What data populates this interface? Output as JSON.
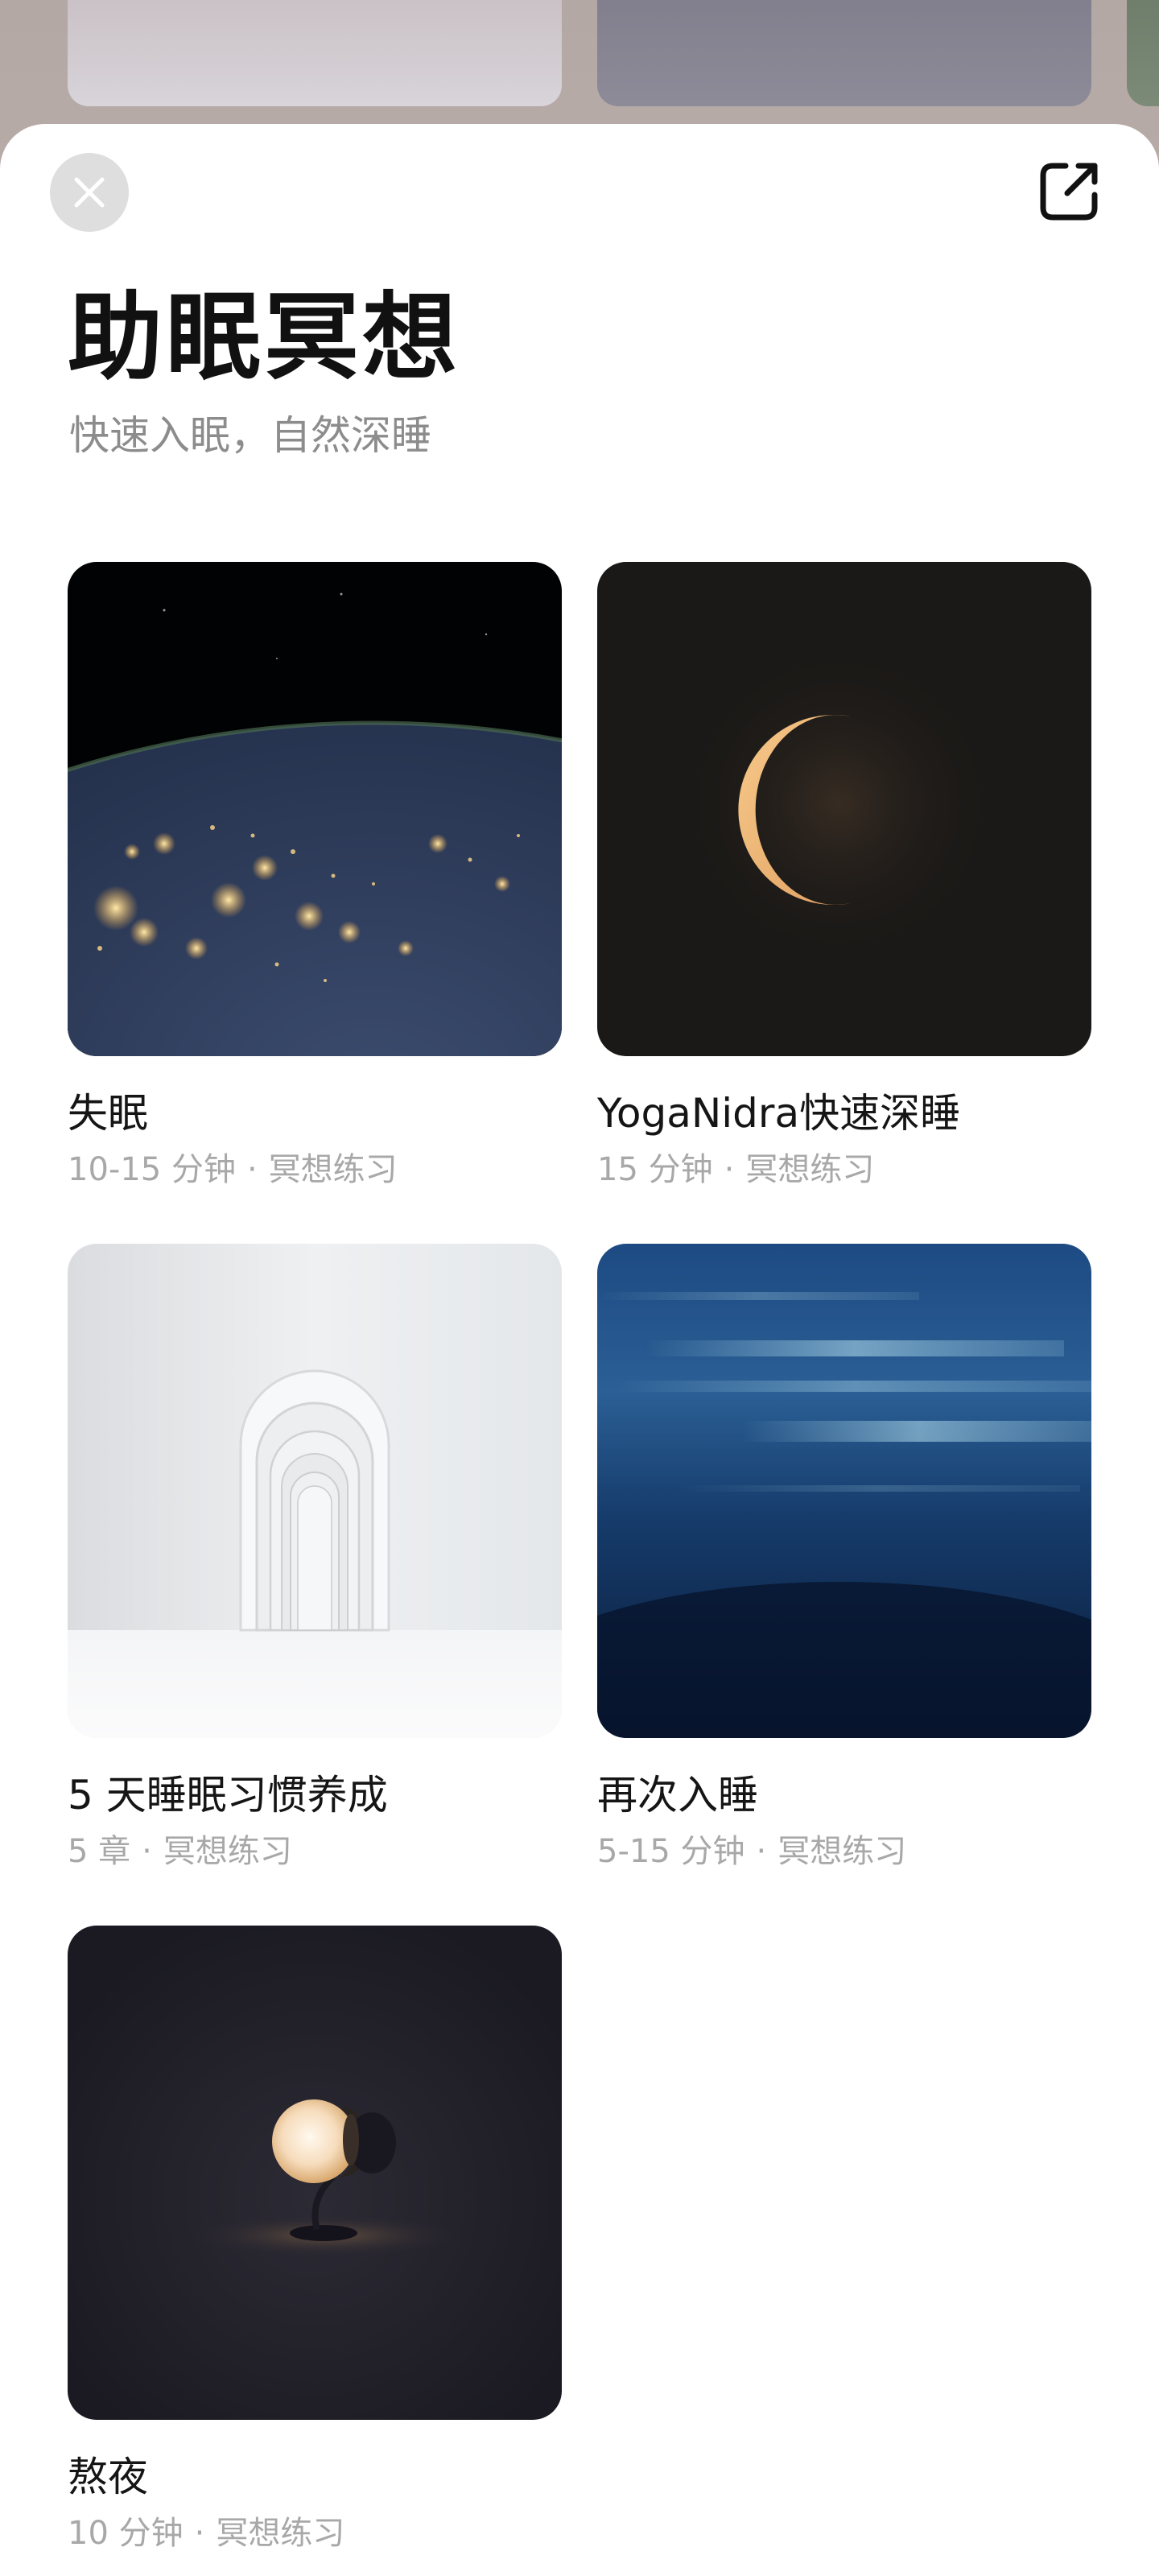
{
  "header": {
    "title": "助眠冥想",
    "subtitle": "快速入眠，自然深睡",
    "close_icon": "close-icon",
    "share_icon": "share-icon"
  },
  "colors": {
    "sheet_background": "#ffffff",
    "title": "#111111",
    "subtitle": "#8c8c8c",
    "meta": "#a8a8a8",
    "close_button_bg": "#dedede"
  },
  "cards": [
    {
      "title": "失眠",
      "duration": "10-15 分钟",
      "separator": "·",
      "category": "冥想练习",
      "image": "earth-at-night"
    },
    {
      "title": "YogaNidra快速深睡",
      "duration": "15 分钟",
      "separator": "·",
      "category": "冥想练习",
      "image": "crescent-moon"
    },
    {
      "title": "5 天睡眠习惯养成",
      "duration": "5 章",
      "separator": "·",
      "category": "冥想练习",
      "image": "white-arches"
    },
    {
      "title": "再次入睡",
      "duration": "5-15 分钟",
      "separator": "·",
      "category": "冥想练习",
      "image": "blue-water"
    },
    {
      "title": "熬夜",
      "duration": "10 分钟",
      "separator": "·",
      "category": "冥想练习",
      "image": "desk-lamp"
    }
  ]
}
